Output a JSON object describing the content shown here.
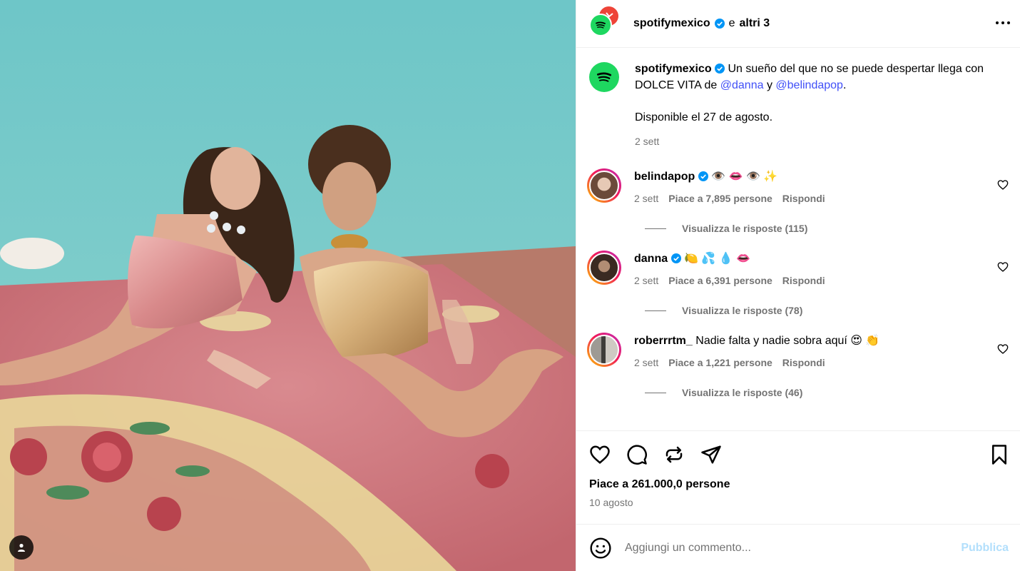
{
  "header": {
    "username": "spotifymexico",
    "and": "e",
    "others": "altri 3"
  },
  "caption": {
    "username": "spotifymexico",
    "text_before": "Un sueño del que no se puede despertar llega con DOLCE VITA de",
    "mention1": "@danna",
    "conj": "y",
    "mention2": "@belindapop",
    "period": ".",
    "line2": "Disponible el 27 de agosto.",
    "time": "2 sett"
  },
  "comments": [
    {
      "username": "belindapop",
      "verified": true,
      "text": "👁️ 👄 👁️ ✨",
      "time": "2 sett",
      "likes": "Piace a 7,895 persone",
      "reply": "Rispondi",
      "view_replies": "Visualizza le risposte (115)"
    },
    {
      "username": "danna",
      "verified": true,
      "text": "🍋 💦 💧 👄",
      "time": "2 sett",
      "likes": "Piace a 6,391 persone",
      "reply": "Rispondi",
      "view_replies": "Visualizza le risposte (78)"
    },
    {
      "username": "roberrrtm_",
      "verified": false,
      "text": "Nadie falta y nadie sobra aquí 😍 👏",
      "time": "2 sett",
      "likes": "Piace a 1,221 persone",
      "reply": "Rispondi",
      "view_replies": "Visualizza le risposte (46)"
    }
  ],
  "post": {
    "likes": "Piace a 261.000,0 persone",
    "date": "10 agosto"
  },
  "composer": {
    "placeholder": "Aggiungi un commento...",
    "publish": "Pubblica"
  },
  "colors": {
    "spotify_green": "#1ed760",
    "link_blue": "#4150f7",
    "verified_blue": "#0095f6",
    "publish_disabled": "#b2dffc"
  }
}
